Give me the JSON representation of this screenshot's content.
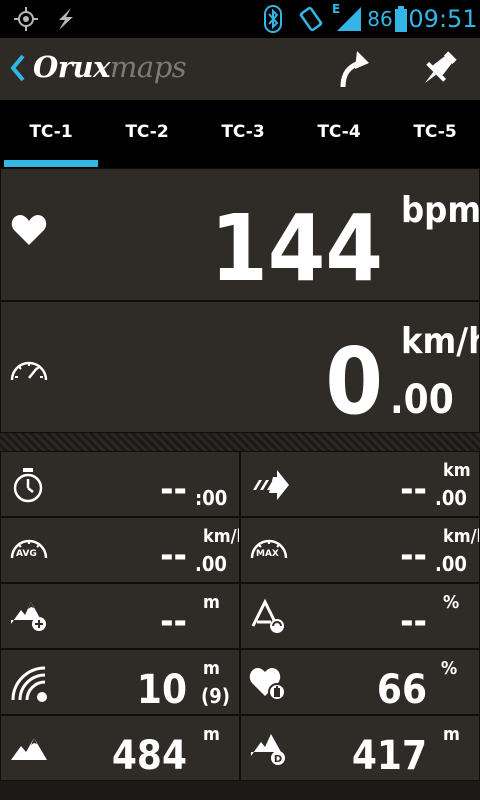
{
  "status_bar": {
    "icons": [
      "gps-icon",
      "power-icon",
      "bluetooth-icon",
      "vibrate-icon",
      "edge-signal-icon",
      "battery-icon"
    ],
    "network": "E",
    "battery": "86",
    "time": "09:51",
    "accent": "#33b5e5"
  },
  "action_bar": {
    "logo_bold": "Orux",
    "logo_light": "maps",
    "buttons": [
      "turn-up-arrow-icon",
      "pin-icon"
    ]
  },
  "tabs": {
    "items": [
      "TC-1",
      "TC-2",
      "TC-3",
      "TC-4",
      "TC-5"
    ],
    "selected": "TC-1"
  },
  "heart_rate": {
    "value": "144",
    "unit": "bpm",
    "icon": "heart-icon"
  },
  "speed": {
    "value": "0",
    "decimal": ".00",
    "unit": "km/h",
    "icon": "speedometer-icon"
  },
  "grid": {
    "timer": {
      "value": "--",
      "decimal": ":00",
      "icon": "stopwatch-icon"
    },
    "distance": {
      "value": "--",
      "decimal": ".00",
      "unit": "km",
      "icon": "distance-arrow-icon"
    },
    "avg_speed": {
      "value": "--",
      "decimal": ".00",
      "unit": "km/h",
      "icon": "avg-speedometer-icon",
      "icon_label": "AVG"
    },
    "max_speed": {
      "value": "--",
      "decimal": ".00",
      "unit": "km/h",
      "icon": "max-speedometer-icon",
      "icon_label": "MAX"
    },
    "ascent": {
      "value": "--",
      "unit": "m",
      "icon": "mountain-plus-icon"
    },
    "slope": {
      "value": "--",
      "unit": "%",
      "icon": "slope-icon"
    },
    "gps_accuracy": {
      "value": "10",
      "unit": "m",
      "extra": "(9)",
      "icon": "gps-accuracy-icon"
    },
    "hr_percent": {
      "value": "66",
      "unit": "%",
      "icon": "heart-battery-icon"
    },
    "altitude": {
      "value": "484",
      "unit": "m",
      "icon": "mountain-icon"
    },
    "altitude_d": {
      "value": "417",
      "unit": "m",
      "icon": "mountain-d-icon"
    }
  }
}
